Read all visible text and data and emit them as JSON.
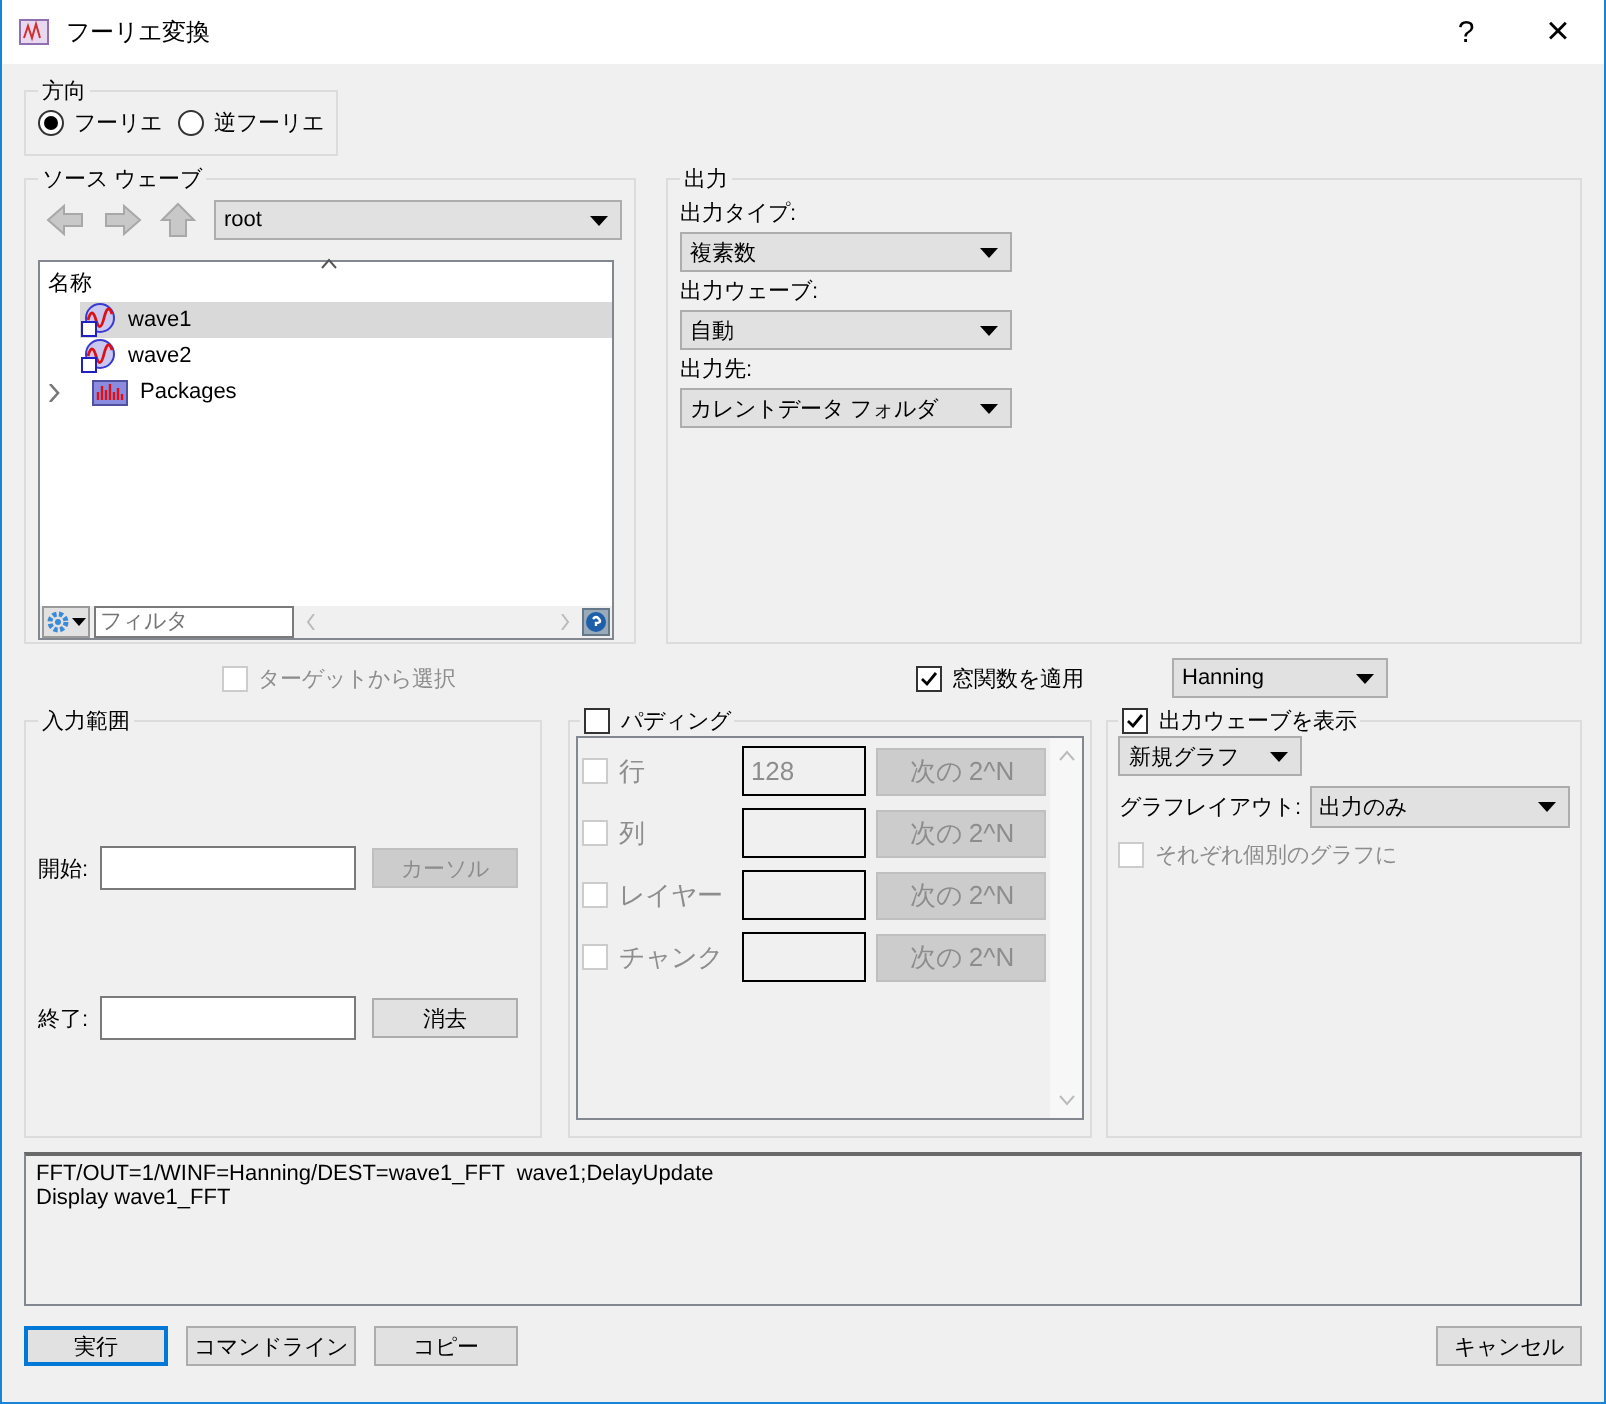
{
  "window": {
    "title": "フーリエ変換",
    "help": "?",
    "close": "×"
  },
  "direction": {
    "label": "方向",
    "options": [
      {
        "label": "フーリエ",
        "selected": true
      },
      {
        "label": "逆フーリエ",
        "selected": false
      }
    ]
  },
  "source": {
    "label": "ソース ウェーブ",
    "folder": "root",
    "column": "名称",
    "filter_placeholder": "フィルタ",
    "items": [
      {
        "name": "wave1",
        "kind": "wave",
        "selected": true
      },
      {
        "name": "wave2",
        "kind": "wave",
        "selected": false
      },
      {
        "name": "Packages",
        "kind": "folder",
        "selected": false,
        "expanded": false
      }
    ]
  },
  "output": {
    "label": "出力",
    "fields": [
      {
        "label": "出力タイプ:",
        "value": "複素数"
      },
      {
        "label": "出力ウェーブ:",
        "value": "自動"
      },
      {
        "label": "出力先:",
        "value": "カレントデータ フォルダ"
      }
    ]
  },
  "from_target": {
    "label": "ターゲットから選択",
    "checked": false,
    "disabled": true
  },
  "window_function": {
    "label": "窓関数を適用",
    "checked": true,
    "value": "Hanning"
  },
  "input_range": {
    "label": "入力範囲",
    "start_label": "開始:",
    "cursor_button": "カーソル",
    "cursor_disabled": true,
    "end_label": "終了:",
    "clear_button": "消去"
  },
  "padding": {
    "label": "パディング",
    "checked": false,
    "rows": [
      {
        "label": "行",
        "value": "128",
        "button": "次の 2^N",
        "checked": false
      },
      {
        "label": "列",
        "button": "次の 2^N",
        "checked": false
      },
      {
        "label": "レイヤー",
        "button": "次の 2^N",
        "checked": false
      },
      {
        "label": "チャンク",
        "button": "次の 2^N",
        "checked": false
      }
    ]
  },
  "display": {
    "label": "出力ウェーブを表示",
    "checked": true,
    "graph": "新規グラフ",
    "layout_label": "グラフレイアウト:",
    "layout": "出力のみ",
    "separate": {
      "label": "それぞれ個別のグラフに",
      "checked": false,
      "disabled": true
    }
  },
  "command": [
    "FFT/OUT=1/WINF=Hanning/DEST=wave1_FFT  wave1;DelayUpdate",
    "Display wave1_FFT"
  ],
  "buttons": [
    {
      "label": "実行",
      "default": true
    },
    {
      "label": "コマンドライン",
      "default": false
    },
    {
      "label": "コピー",
      "default": false
    }
  ],
  "cancel": "キャンセル"
}
